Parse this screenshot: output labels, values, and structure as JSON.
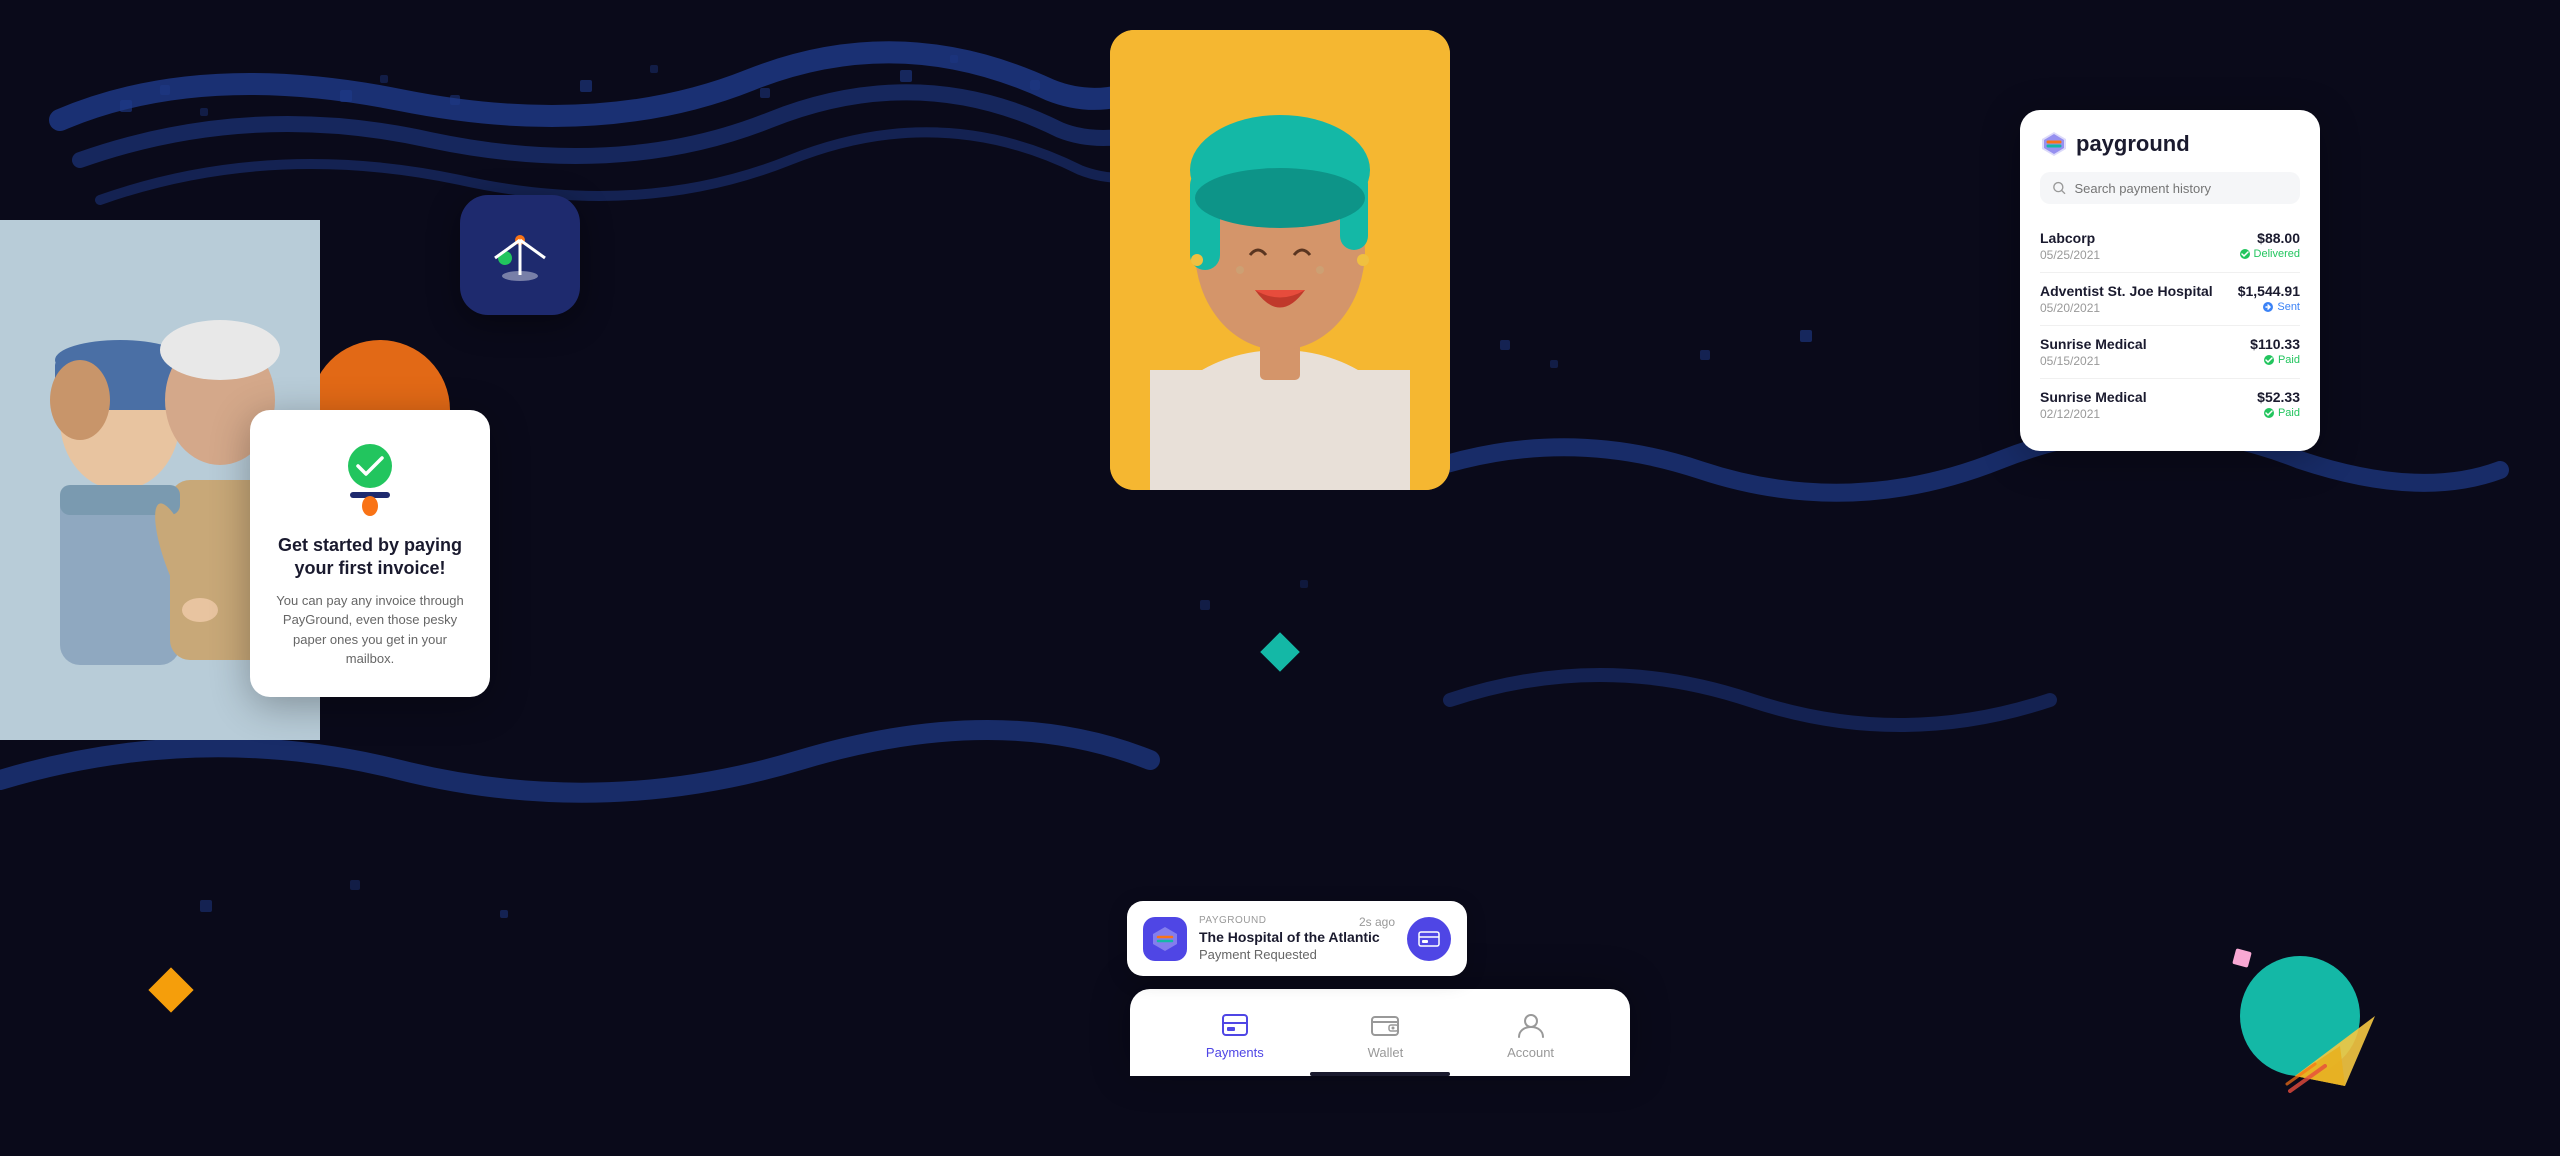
{
  "app": {
    "name": "payground",
    "background_color": "#0a0a1a"
  },
  "payment_card": {
    "title": "payground",
    "search_placeholder": "Search payment history",
    "payments": [
      {
        "provider": "Labcorp",
        "date": "05/25/2021",
        "amount": "$88.00",
        "status": "Delivered",
        "status_type": "delivered"
      },
      {
        "provider": "Adventist St. Joe Hospital",
        "date": "05/20/2021",
        "amount": "$1,544.91",
        "status": "Sent",
        "status_type": "sent"
      },
      {
        "provider": "Sunrise Medical",
        "date": "05/15/2021",
        "amount": "$110.33",
        "status": "Paid",
        "status_type": "paid"
      },
      {
        "provider": "Sunrise Medical",
        "date": "02/12/2021",
        "amount": "$52.33",
        "status": "Paid",
        "status_type": "paid"
      }
    ]
  },
  "invoice_card": {
    "title": "Get started by paying your first invoice!",
    "description": "You can pay any invoice through PayGround, even those pesky paper ones you get in your mailbox."
  },
  "mobile_tabs": [
    {
      "label": "Payments",
      "active": true,
      "icon": "payments-icon"
    },
    {
      "label": "Wallet",
      "active": false,
      "icon": "wallet-icon"
    },
    {
      "label": "Account",
      "active": false,
      "icon": "account-icon"
    }
  ],
  "notification": {
    "source": "PAYGROUND",
    "time": "2s ago",
    "provider": "The Hospital of the Atlantic",
    "action": "Payment Requested"
  },
  "diamond_teal_color": "#14b8a6",
  "diamond_yellow_color": "#f59e0b"
}
